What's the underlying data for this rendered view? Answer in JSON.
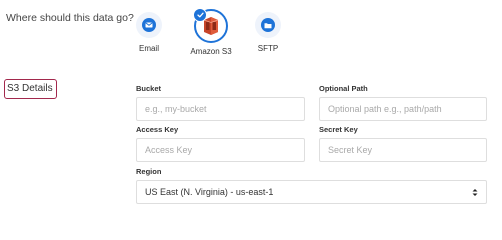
{
  "question": "Where should this data go?",
  "destinations": [
    {
      "label": "Email",
      "icon": "email-icon",
      "selected": false
    },
    {
      "label": "Amazon S3",
      "icon": "amazon-s3-icon",
      "selected": true
    },
    {
      "label": "SFTP",
      "icon": "sftp-icon",
      "selected": false
    }
  ],
  "section_title": "S3 Details",
  "fields": {
    "bucket": {
      "label": "Bucket",
      "placeholder": "e.g., my-bucket",
      "value": ""
    },
    "optional_path": {
      "label": "Optional Path",
      "placeholder": "Optional path e.g., path/path",
      "value": ""
    },
    "access_key": {
      "label": "Access Key",
      "placeholder": "Access Key",
      "value": ""
    },
    "secret_key": {
      "label": "Secret Key",
      "placeholder": "Secret Key",
      "value": ""
    },
    "region": {
      "label": "Region",
      "value": "US East (N. Virginia) - us-east-1"
    }
  },
  "colors": {
    "accent": "#1e73d8",
    "section_highlight": "#a2284c",
    "s3_brand": "#c7452a"
  }
}
